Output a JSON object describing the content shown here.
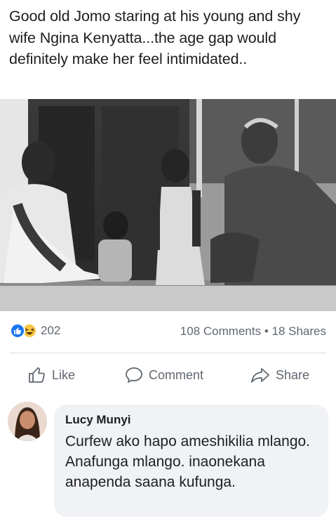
{
  "post": {
    "text": "Good old Jomo staring at his young and shy wife Ngina Kenyatta...the age gap would definitely make her feel intimidated.."
  },
  "reactions": {
    "icons": [
      "like-icon",
      "haha-icon"
    ],
    "count": "202",
    "comments": "108 Comments",
    "separator": "•",
    "shares": "18 Shares"
  },
  "actions": {
    "like": "Like",
    "comment": "Comment",
    "share": "Share"
  },
  "comment": {
    "author": "Lucy Munyi",
    "text": "Curfew ako hapo ameshikilia mlango. Anafunga mlango. inaonekana anapenda saana kufunga."
  },
  "colors": {
    "like_blue": "#1877f2",
    "haha_yellow": "#f7c843",
    "muted_text": "#606770",
    "bubble_bg": "#f0f2f5"
  }
}
